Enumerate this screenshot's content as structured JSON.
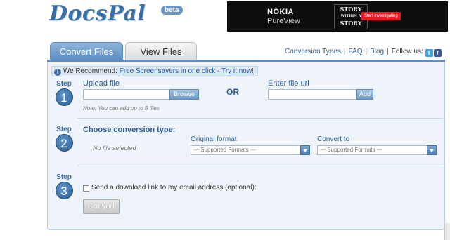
{
  "header": {
    "logo": "DocsPal",
    "badge": "beta"
  },
  "ad": {
    "brand": "NOKIA",
    "model": "PureView",
    "story_line1": "STORY",
    "story_line2": "WITHIN A",
    "story_line3": "STORY",
    "cta": "Start investigating"
  },
  "tabs": [
    {
      "label": "Convert Files",
      "active": true
    },
    {
      "label": "View Files",
      "active": false
    }
  ],
  "toplinks": {
    "conversion_types": "Conversion Types",
    "faq": "FAQ",
    "blog": "Blog",
    "follow": "Follow us:",
    "sep": "|"
  },
  "recommend": {
    "prefix": "We Recommend:",
    "link": "Free Screensavers in one click - Try it now!"
  },
  "steps": [
    {
      "label": "Step",
      "number": "1"
    },
    {
      "label": "Step",
      "number": "2"
    },
    {
      "label": "Step",
      "number": "3"
    }
  ],
  "step1": {
    "upload_label": "Upload file",
    "browse": "Browse",
    "note": "Note: You can add up to 5 files",
    "or": "OR",
    "url_label": "Enter file url",
    "add": "Add"
  },
  "step2": {
    "title": "Choose conversion type:",
    "no_file": "No file selected",
    "original_label": "Original format",
    "original_value": "--- Supported Formats ---",
    "convert_label": "Convert to",
    "convert_value": "--- Supported Formats ---"
  },
  "step3": {
    "email_label": "Send a download link to my email address (optional):",
    "convert_button": "Convert"
  },
  "colors": {
    "brand_blue": "#3e6fa6",
    "panel_bg": "#eef4fa",
    "tab_active": "#5e8fc2"
  }
}
